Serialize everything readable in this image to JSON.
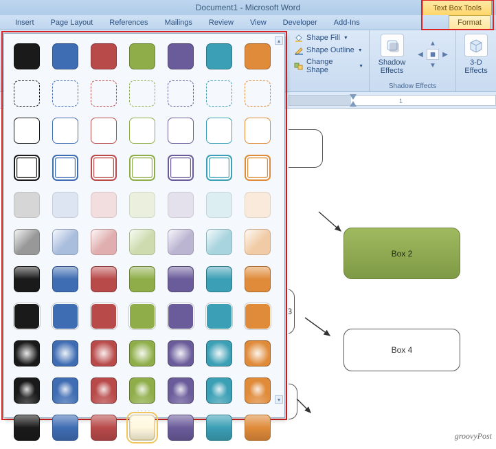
{
  "app": {
    "title": "Document1 - Microsoft Word",
    "context_tool_title": "Text Box Tools"
  },
  "tabs": {
    "items": [
      "Insert",
      "Page Layout",
      "References",
      "Mailings",
      "Review",
      "View",
      "Developer",
      "Add-Ins",
      "Format"
    ],
    "active_index": 8
  },
  "ribbon": {
    "shape_fill": "Shape Fill",
    "shape_outline": "Shape Outline",
    "change_shape": "Change Shape",
    "shadow_effects_btn": "Shadow Effects",
    "shadow_effects_group": "Shadow Effects",
    "threed_effects_btn": "3-D Effects"
  },
  "ruler": {
    "ticks": [
      "1"
    ]
  },
  "document": {
    "box2_label": "Box 2",
    "box4_label": "Box 4",
    "partial_label": "3"
  },
  "gallery": {
    "palette": [
      "#1a1a1a",
      "#3f6db3",
      "#b94a4a",
      "#8fae4a",
      "#6a5b9a",
      "#3b9fb5",
      "#e08b3a"
    ],
    "row_styles": [
      "r1",
      "r2",
      "r3",
      "r4",
      "r5",
      "r6",
      "r7",
      "r8",
      "r9",
      "r10",
      "r11"
    ],
    "solid_rows": [
      0,
      6,
      7,
      8,
      9,
      10
    ],
    "light_rows": [
      4,
      5
    ],
    "hover": {
      "row": 10,
      "col": 3
    }
  },
  "watermark": "groovyPost"
}
